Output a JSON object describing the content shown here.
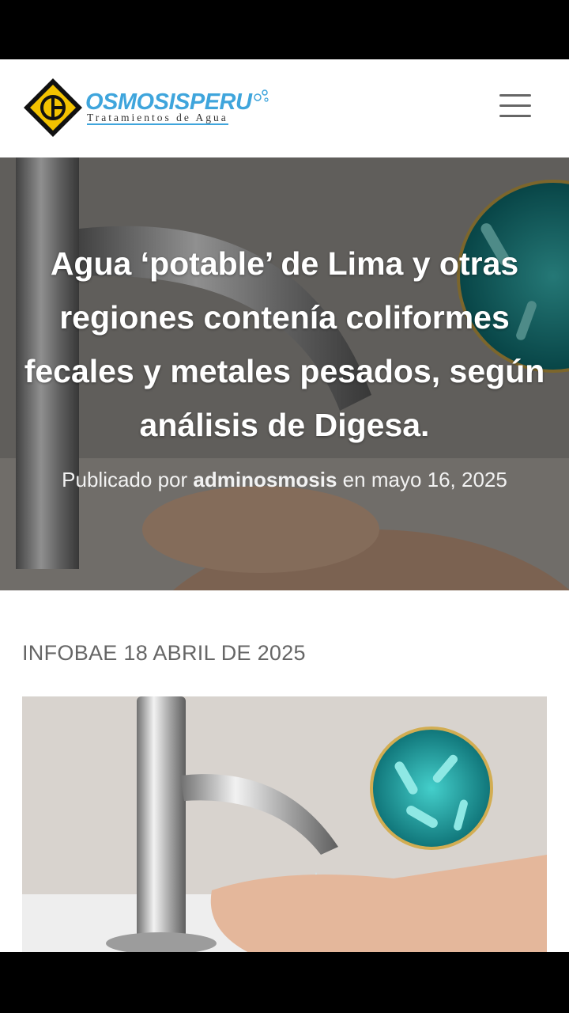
{
  "header": {
    "logo_name": "OSMOSISPERU",
    "logo_tagline": "Tratamientos de Agua"
  },
  "hero": {
    "title": "Agua ‘potable’ de Lima y otras regiones contenía coliformes fecales y metales pesados, según análisis de Digesa.",
    "meta_prefix": "Publicado por ",
    "author": "adminosmosis",
    "meta_middle": " en ",
    "date": "mayo 16, 2025"
  },
  "article": {
    "source_line": "INFOBAE 18 ABRIL DE 2025"
  },
  "icons": [
    "menu-icon",
    "logo-mark-icon"
  ],
  "colors": {
    "brand_blue": "#3fa5dc",
    "logo_gold": "#f3c200",
    "bacteria_teal": "#1aa7a5"
  }
}
